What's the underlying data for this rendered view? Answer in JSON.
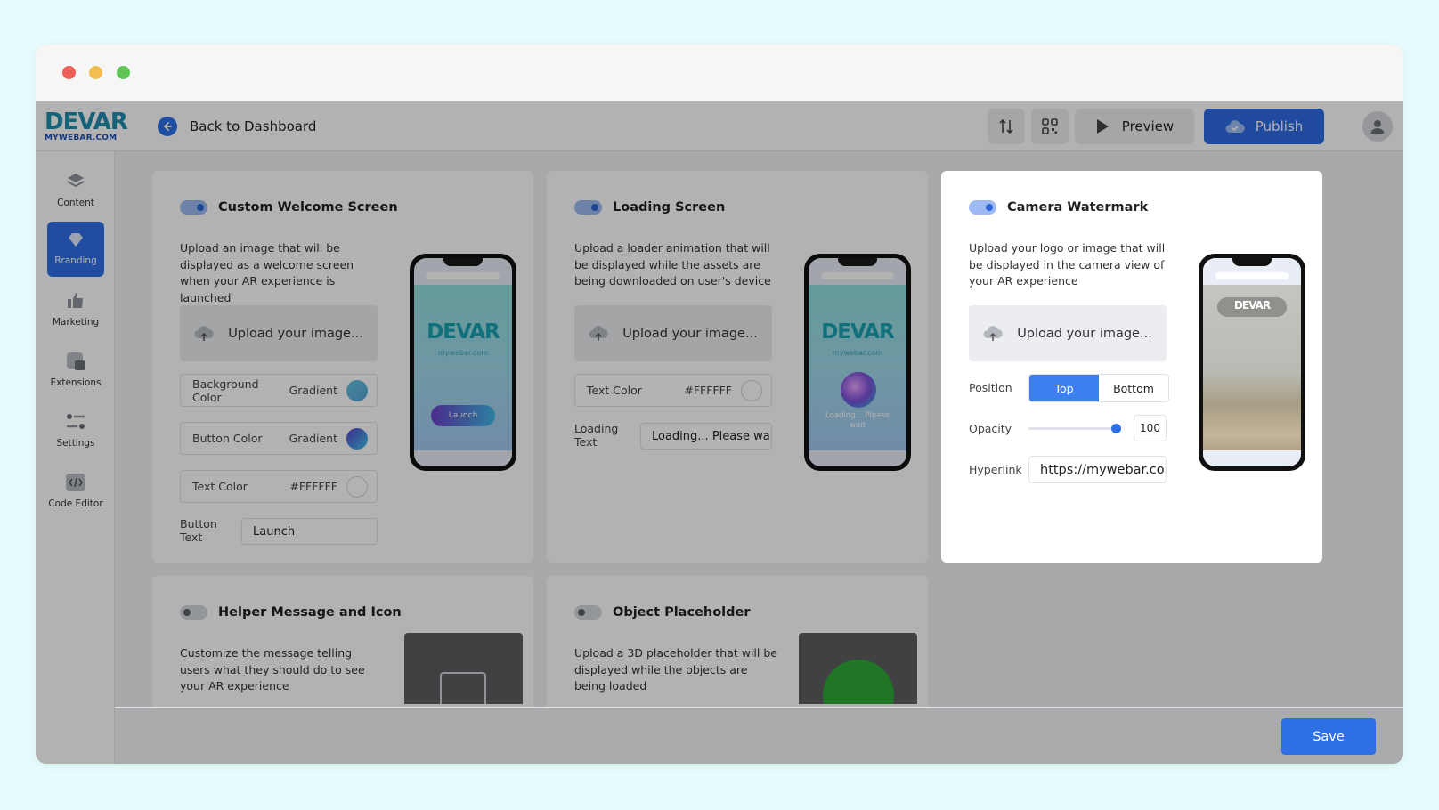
{
  "brand": {
    "logo_word": "DEVAR",
    "logo_sub": "MYWEBAR.COM"
  },
  "header": {
    "back_label": "Back to Dashboard",
    "preview_label": "Preview",
    "publish_label": "Publish"
  },
  "sidebar": {
    "items": [
      {
        "label": "Content",
        "icon": "layers-icon"
      },
      {
        "label": "Branding",
        "icon": "branding-icon",
        "active": true
      },
      {
        "label": "Marketing",
        "icon": "thumbs-up-icon"
      },
      {
        "label": "Extensions",
        "icon": "extensions-icon"
      },
      {
        "label": "Settings",
        "icon": "sliders-icon"
      },
      {
        "label": "Code Editor",
        "icon": "code-icon"
      }
    ]
  },
  "welcome": {
    "title": "Custom Welcome Screen",
    "enabled": true,
    "description": "Upload an image that will be displayed as a welcome screen when your AR experience is launched",
    "upload_label": "Upload your image...",
    "bg_color_label": "Background Color",
    "bg_color_value": "Gradient",
    "button_color_label": "Button Color",
    "button_color_value": "Gradient",
    "text_color_label": "Text Color",
    "text_color_value": "#FFFFFF",
    "button_text_label": "Button Text",
    "button_text_value": "Launch",
    "phone_logo": "DEVAR",
    "phone_sub": "mywebar.com",
    "phone_button": "Launch"
  },
  "loading": {
    "title": "Loading Screen",
    "enabled": true,
    "description": "Upload a loader animation that will be displayed while the assets are being downloaded on user's device",
    "upload_label": "Upload your image...",
    "text_color_label": "Text Color",
    "text_color_value": "#FFFFFF",
    "loading_text_label": "Loading Text",
    "loading_text_value": "Loading... Please wait",
    "phone_logo": "DEVAR",
    "phone_sub": "mywebar.com",
    "phone_loading": "Loading... Please wait"
  },
  "watermark": {
    "title": "Camera Watermark",
    "enabled": true,
    "description": "Upload your logo or image that will be displayed in the camera view of your AR experience",
    "upload_label": "Upload your image...",
    "position_label": "Position",
    "position_options": [
      "Top",
      "Bottom"
    ],
    "position_selected": "Top",
    "opacity_label": "Opacity",
    "opacity_value": "100",
    "hyperlink_label": "Hyperlink",
    "hyperlink_value": "https://mywebar.com",
    "phone_logo": "DEVAR"
  },
  "helper": {
    "title": "Helper Message and Icon",
    "enabled": false,
    "description": "Customize the message telling users what they should do to see your AR experience"
  },
  "placeholder": {
    "title": "Object Placeholder",
    "enabled": false,
    "description": "Upload a 3D placeholder that will be displayed while the objects are being loaded"
  },
  "footer": {
    "save_label": "Save"
  },
  "colors": {
    "accent": "#2F6FE4",
    "brand_teal": "#1F8FB0",
    "brand_blue": "#1D4FB5"
  }
}
